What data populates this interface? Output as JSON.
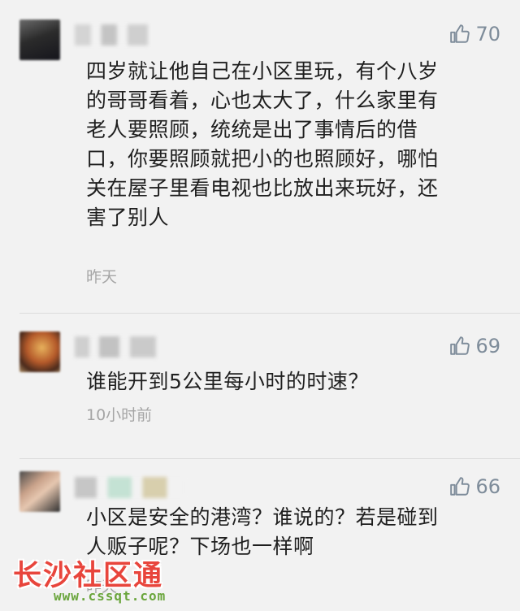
{
  "comments": [
    {
      "likes": "70",
      "content_lines": [
        "四岁就让他自己在小区里玩，有个八岁",
        "的哥哥看着，心也太大了，什么家里有",
        "老人要照顾，统统是出了事情后的借",
        "口，你要照顾就把小的也照顾好，哪怕",
        "关在屋子里看电视也比放出来玩好，还",
        "害了别人"
      ],
      "time": "昨天"
    },
    {
      "likes": "69",
      "content_lines": [
        "谁能开到5公里每小时的时速？"
      ],
      "time": "10小时前"
    },
    {
      "likes": "66",
      "content_lines": [
        "小区是安全的港湾？谁说的？若是碰到",
        "人贩子呢？下场也一样啊"
      ],
      "time": "昨天"
    }
  ],
  "watermark": {
    "title": "长沙社区通",
    "url": "www.cssqt.com"
  },
  "colors": {
    "background": "#f2f2f2",
    "text": "#1f1f1f",
    "meta": "#a5a5a5",
    "like": "#7e8c9a",
    "watermark_red": "#e8453c",
    "watermark_green": "#6aa53c"
  }
}
